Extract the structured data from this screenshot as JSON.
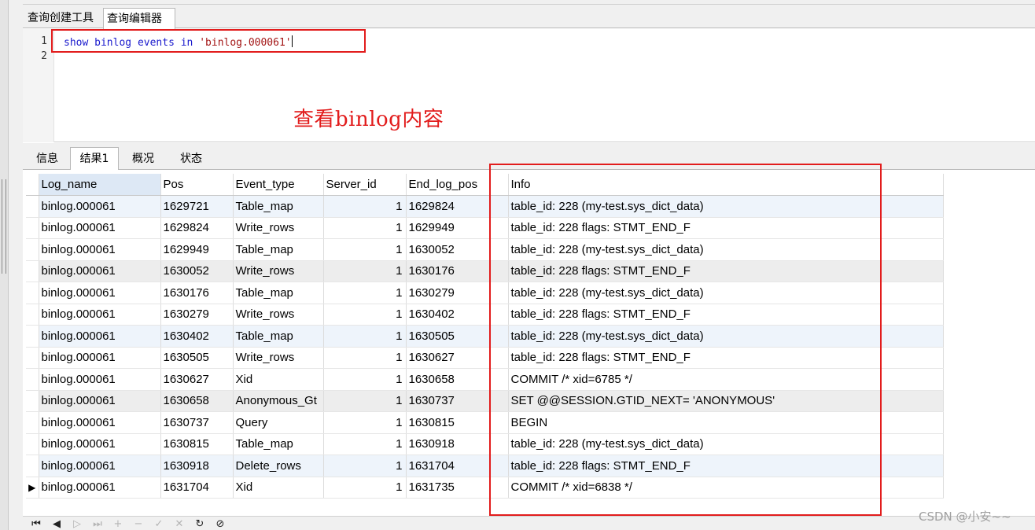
{
  "query_tabs": [
    {
      "label": "查询创建工具"
    },
    {
      "label": "查询编辑器"
    }
  ],
  "editor": {
    "line_numbers": [
      "1",
      "2"
    ],
    "code": {
      "kw1": "show",
      "kw2": "binlog",
      "kw3": "events",
      "kw4": "in",
      "str": "'binlog.000061'"
    }
  },
  "annotation": "查看binlog内容",
  "result_tabs": [
    {
      "label": "信息"
    },
    {
      "label": "结果1"
    },
    {
      "label": "概况"
    },
    {
      "label": "状态"
    }
  ],
  "grid": {
    "columns": [
      "Log_name",
      "Pos",
      "Event_type",
      "Server_id",
      "End_log_pos",
      "Info"
    ],
    "rows": [
      {
        "log_name": "binlog.000061",
        "pos": "1629721",
        "event_type": "Table_map",
        "server_id": "1",
        "end_log_pos": "1629824",
        "info": "table_id: 228 (my-test.sys_dict_data)"
      },
      {
        "log_name": "binlog.000061",
        "pos": "1629824",
        "event_type": "Write_rows",
        "server_id": "1",
        "end_log_pos": "1629949",
        "info": "table_id: 228 flags: STMT_END_F"
      },
      {
        "log_name": "binlog.000061",
        "pos": "1629949",
        "event_type": "Table_map",
        "server_id": "1",
        "end_log_pos": "1630052",
        "info": "table_id: 228 (my-test.sys_dict_data)"
      },
      {
        "log_name": "binlog.000061",
        "pos": "1630052",
        "event_type": "Write_rows",
        "server_id": "1",
        "end_log_pos": "1630176",
        "info": "table_id: 228 flags: STMT_END_F"
      },
      {
        "log_name": "binlog.000061",
        "pos": "1630176",
        "event_type": "Table_map",
        "server_id": "1",
        "end_log_pos": "1630279",
        "info": "table_id: 228 (my-test.sys_dict_data)"
      },
      {
        "log_name": "binlog.000061",
        "pos": "1630279",
        "event_type": "Write_rows",
        "server_id": "1",
        "end_log_pos": "1630402",
        "info": "table_id: 228 flags: STMT_END_F"
      },
      {
        "log_name": "binlog.000061",
        "pos": "1630402",
        "event_type": "Table_map",
        "server_id": "1",
        "end_log_pos": "1630505",
        "info": "table_id: 228 (my-test.sys_dict_data)"
      },
      {
        "log_name": "binlog.000061",
        "pos": "1630505",
        "event_type": "Write_rows",
        "server_id": "1",
        "end_log_pos": "1630627",
        "info": "table_id: 228 flags: STMT_END_F"
      },
      {
        "log_name": "binlog.000061",
        "pos": "1630627",
        "event_type": "Xid",
        "server_id": "1",
        "end_log_pos": "1630658",
        "info": "COMMIT /* xid=6785 */"
      },
      {
        "log_name": "binlog.000061",
        "pos": "1630658",
        "event_type": "Anonymous_Gt",
        "server_id": "1",
        "end_log_pos": "1630737",
        "info": "SET @@SESSION.GTID_NEXT= 'ANONYMOUS'"
      },
      {
        "log_name": "binlog.000061",
        "pos": "1630737",
        "event_type": "Query",
        "server_id": "1",
        "end_log_pos": "1630815",
        "info": "BEGIN"
      },
      {
        "log_name": "binlog.000061",
        "pos": "1630815",
        "event_type": "Table_map",
        "server_id": "1",
        "end_log_pos": "1630918",
        "info": "table_id: 228 (my-test.sys_dict_data)"
      },
      {
        "log_name": "binlog.000061",
        "pos": "1630918",
        "event_type": "Delete_rows",
        "server_id": "1",
        "end_log_pos": "1631704",
        "info": "table_id: 228 flags: STMT_END_F"
      },
      {
        "log_name": "binlog.000061",
        "pos": "1631704",
        "event_type": "Xid",
        "server_id": "1",
        "end_log_pos": "1631735",
        "info": "COMMIT /* xid=6838 */"
      }
    ],
    "current_row_marker": "▶"
  },
  "nav": {
    "first": "⏮",
    "prev": "◀",
    "next": "▷",
    "last": "⏭",
    "add": "+",
    "delete": "−",
    "check": "✓",
    "cancel": "✕",
    "refresh": "↻",
    "stop": "⊘"
  },
  "watermark": "CSDN @小安~~"
}
